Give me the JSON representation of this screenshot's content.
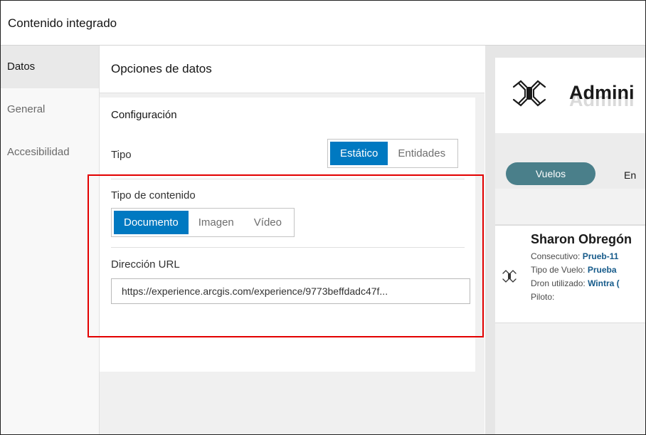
{
  "window": {
    "title": "Contenido integrado"
  },
  "sidebar": {
    "items": [
      {
        "label": "Datos",
        "active": true
      },
      {
        "label": "General",
        "active": false
      },
      {
        "label": "Accesibilidad",
        "active": false
      }
    ]
  },
  "panel": {
    "header": "Opciones de datos",
    "section_title": "Configuración",
    "tipo": {
      "label": "Tipo",
      "options": [
        "Estático",
        "Entidades"
      ],
      "selected": "Estático"
    },
    "tipo_contenido": {
      "label": "Tipo de contenido",
      "options": [
        "Documento",
        "Imagen",
        "Vídeo"
      ],
      "selected": "Documento"
    },
    "url": {
      "label": "Dirección URL",
      "value": "https://experience.arcgis.com/experience/9773beffdadc47f..."
    }
  },
  "preview": {
    "title": "Admini",
    "tabs": [
      "Vuelos",
      "En"
    ],
    "card": {
      "name": "Sharon Obregón",
      "consecutivo_label": "Consecutivo:",
      "consecutivo_value": "Prueb-11",
      "tipo_vuelo_label": "Tipo de Vuelo:",
      "tipo_vuelo_value": "Prueba",
      "dron_label": "Dron utilizado:",
      "dron_value": "Wintra (",
      "piloto_label": "Piloto:"
    }
  },
  "colors": {
    "accent": "#0079c1",
    "highlight": "#e30000",
    "pill": "#4a7f8a"
  }
}
